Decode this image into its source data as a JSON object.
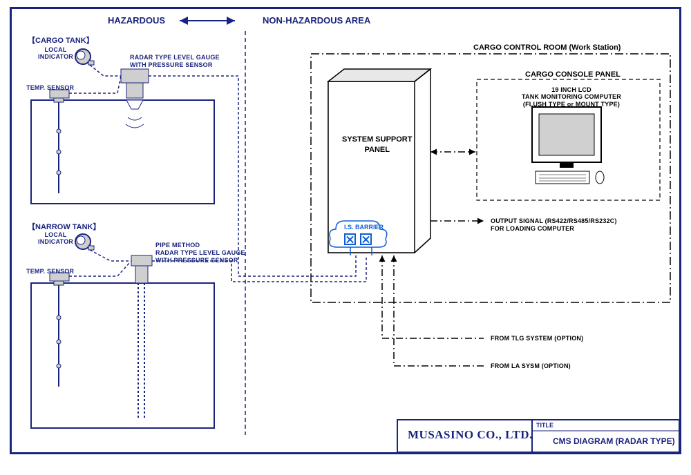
{
  "header": {
    "left": "HAZARDOUS",
    "right": "NON-HAZARDOUS AREA"
  },
  "cargo_tank": {
    "title": "【CARGO TANK】",
    "local_indicator": "LOCAL\nINDICATOR",
    "temp_sensor": "TEMP. SENSOR",
    "radar_label": "RADAR TYPE LEVEL GAUGE\nWITH PRESSURE SENSOR"
  },
  "narrow_tank": {
    "title": "【NARROW TANK】",
    "local_indicator": "LOCAL\nINDICATOR",
    "temp_sensor": "TEMP. SENSOR",
    "radar_label": "PIPE METHOD\nRADAR TYPE LEVEL GAUGE\nWITH PRESSURE SENSOR"
  },
  "room": {
    "title": "CARGO CONTROL ROOM (Work Station)",
    "ssp": "SYSTEM SUPPORT\nPANEL",
    "barrier": "I.S. BARRIER",
    "console_title": "CARGO CONSOLE PANEL",
    "monitor_label": "19 INCH LCD\nTANK MONITORING COMPUTER\n(FLUSH TYPE or MOUNT TYPE)",
    "output_signal": "OUTPUT SIGNAL (RS422/RS485/RS232C)\nFOR LOADING COMPUTER"
  },
  "options": {
    "tlg": "FROM TLG SYSTEM (OPTION)",
    "la": "FROM LA SYSM (OPTION)"
  },
  "titleblock": {
    "company": "MUSASINO CO., LTD.",
    "title_label": "TITLE",
    "title_value": "CMS DIAGRAM (RADAR TYPE)"
  }
}
